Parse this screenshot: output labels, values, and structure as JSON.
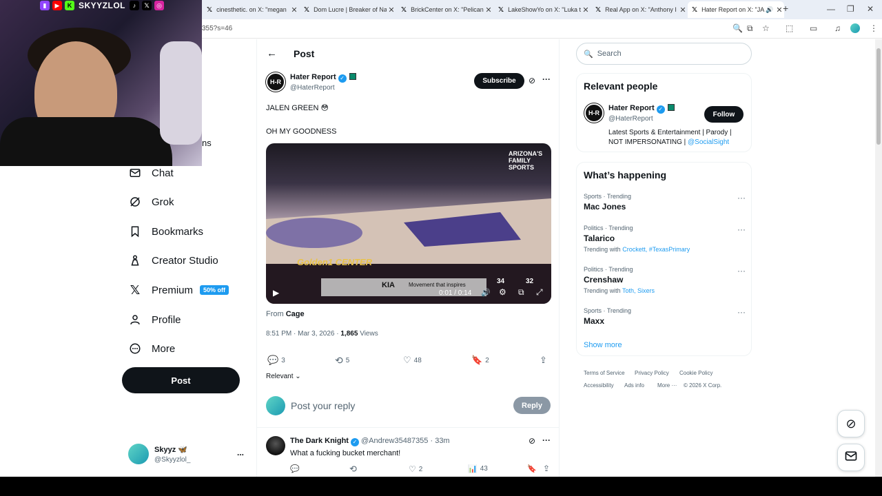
{
  "browser": {
    "tabs": [
      {
        "title": "cinesthetic. on X: \"megan"
      },
      {
        "title": "Dom Lucre | Breaker of Na"
      },
      {
        "title": "BrickCenter on X: \"Pelican"
      },
      {
        "title": "LakeShowYo on X: \"Luka t"
      },
      {
        "title": "Real App on X: \"Anthony I"
      },
      {
        "title": "Hater Report on X: \"JA"
      }
    ],
    "url_fragment": "355?s=46"
  },
  "overlay": {
    "handle": "SKYYZLOL",
    "nav_fragment": "ns"
  },
  "sidebar": {
    "items": [
      {
        "label": "Chat",
        "icon": "mail-icon"
      },
      {
        "label": "Grok",
        "icon": "grok-icon"
      },
      {
        "label": "Bookmarks",
        "icon": "bookmark-icon"
      },
      {
        "label": "Creator Studio",
        "icon": "creator-icon"
      },
      {
        "label": "Premium",
        "icon": "x-logo-icon",
        "badge": "50% off"
      },
      {
        "label": "Profile",
        "icon": "person-icon"
      },
      {
        "label": "More",
        "icon": "more-circle-icon"
      }
    ],
    "post_button": "Post",
    "user": {
      "name": "Skyyz 🦋",
      "handle": "@Skyyzlol_",
      "more": "..."
    }
  },
  "post": {
    "header_title": "Post",
    "author_name": "Hater Report",
    "author_handle": "@HaterReport",
    "avatar_text": "H-R",
    "subscribe_label": "Subscribe",
    "text_line1": "JALEN GREEN 😳",
    "text_line2": "OH MY GOODNESS",
    "video": {
      "network": "ARIZONA'S FAMILY SPORTS",
      "ad_text": "Movement that inspires",
      "brand": "KIA",
      "score_away": "34",
      "score_home": "32",
      "time": "0:01 / 0:14",
      "arena": "Golden1 CENTER"
    },
    "from_label": "From",
    "from_name": "Cage",
    "timestamp": "8:51 PM · Mar 3, 2026 · ",
    "views_count": "1,865",
    "views_label": " Views",
    "replies": "3",
    "reposts": "5",
    "likes": "48",
    "bookmarks": "2",
    "sort_label": "Relevant",
    "reply_placeholder": "Post your reply",
    "reply_button": "Reply"
  },
  "reply": {
    "author_name": "The Dark Knight",
    "author_handle": "@Andrew35487355 · 33m",
    "text": "What a fucking bucket merchant!",
    "likes": "2",
    "views": "43"
  },
  "right": {
    "search_placeholder": "Search",
    "relevant_title": "Relevant people",
    "rp_name": "Hater Report",
    "rp_handle": "@HaterReport",
    "rp_bio": "Latest Sports & Entertainment | Parody | NOT IMPERSONATING | ",
    "rp_bio_link": "@SocialSight",
    "follow_label": "Follow",
    "happening_title": "What’s happening",
    "trends": [
      {
        "meta": "Sports · Trending",
        "name": "Mac Jones",
        "ctx_prefix": "",
        "ctx_links": ""
      },
      {
        "meta": "Politics · Trending",
        "name": "Talarico",
        "ctx_prefix": "Trending with ",
        "ctx_links": "Crockett, #TexasPrimary"
      },
      {
        "meta": "Politics · Trending",
        "name": "Crenshaw",
        "ctx_prefix": "Trending with ",
        "ctx_links": "Toth, Sixers"
      },
      {
        "meta": "Sports · Trending",
        "name": "Maxx",
        "ctx_prefix": "",
        "ctx_links": ""
      }
    ],
    "show_more": "Show more",
    "footer": [
      "Terms of Service",
      "Privacy Policy",
      "Cookie Policy",
      "Accessibility",
      "Ads info",
      "More ···",
      "© 2026 X Corp."
    ]
  },
  "colors": {
    "accent": "#1d9bf0",
    "text": "#0f1419",
    "muted": "#536471"
  }
}
